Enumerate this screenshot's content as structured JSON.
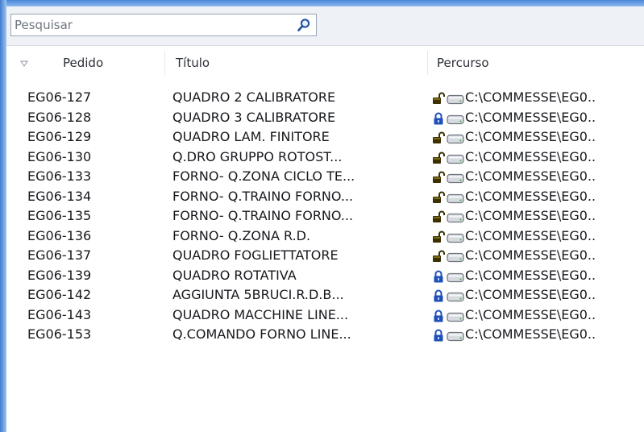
{
  "search": {
    "placeholder": "Pesquisar",
    "value": ""
  },
  "columns": {
    "pedido": "Pedido",
    "titulo": "Título",
    "percurso": "Percurso"
  },
  "rows": [
    {
      "pedido": "EG06-127",
      "titulo": "QUADRO 2 CALIBRATORE",
      "lock": "open",
      "percurso": "C:\\COMMESSE\\EG0.."
    },
    {
      "pedido": "EG06-128",
      "titulo": "QUADRO 3 CALIBRATORE",
      "lock": "closed",
      "percurso": "C:\\COMMESSE\\EG0.."
    },
    {
      "pedido": "EG06-129",
      "titulo": "QUADRO LAM. FINITORE",
      "lock": "open",
      "percurso": "C:\\COMMESSE\\EG0.."
    },
    {
      "pedido": "EG06-130",
      "titulo": "Q.DRO GRUPPO ROTOST...",
      "lock": "open",
      "percurso": "C:\\COMMESSE\\EG0.."
    },
    {
      "pedido": "EG06-133",
      "titulo": "FORNO- Q.ZONA CICLO TE...",
      "lock": "open",
      "percurso": "C:\\COMMESSE\\EG0.."
    },
    {
      "pedido": "EG06-134",
      "titulo": "FORNO- Q.TRAINO FORNO...",
      "lock": "open",
      "percurso": "C:\\COMMESSE\\EG0.."
    },
    {
      "pedido": "EG06-135",
      "titulo": "FORNO- Q.TRAINO FORNO...",
      "lock": "open",
      "percurso": "C:\\COMMESSE\\EG0.."
    },
    {
      "pedido": "EG06-136",
      "titulo": "FORNO- Q.ZONA R.D.",
      "lock": "open",
      "percurso": "C:\\COMMESSE\\EG0.."
    },
    {
      "pedido": "EG06-137",
      "titulo": "QUADRO FOGLIETTATORE",
      "lock": "open",
      "percurso": "C:\\COMMESSE\\EG0.."
    },
    {
      "pedido": "EG06-139",
      "titulo": "QUADRO ROTATIVA",
      "lock": "closed",
      "percurso": "C:\\COMMESSE\\EG0.."
    },
    {
      "pedido": "EG06-142",
      "titulo": "AGGIUNTA 5BRUCI.R.D.B...",
      "lock": "closed",
      "percurso": "C:\\COMMESSE\\EG0.."
    },
    {
      "pedido": "EG06-143",
      "titulo": "QUADRO MACCHINE LINE...",
      "lock": "closed",
      "percurso": "C:\\COMMESSE\\EG0.."
    },
    {
      "pedido": "EG06-153",
      "titulo": "Q.COMANDO FORNO LINE...",
      "lock": "closed",
      "percurso": "C:\\COMMESSE\\EG0.."
    }
  ],
  "icons": {
    "search": "magnifier-icon",
    "sort": "sort-descending-icon",
    "open": "unlocked-padlock-icon",
    "closed": "locked-padlock-icon",
    "drive": "drive-icon"
  },
  "colors": {
    "lock_open": "#3a3000",
    "lock_closed": "#1f4fb8",
    "frame": "#4a86d8"
  }
}
